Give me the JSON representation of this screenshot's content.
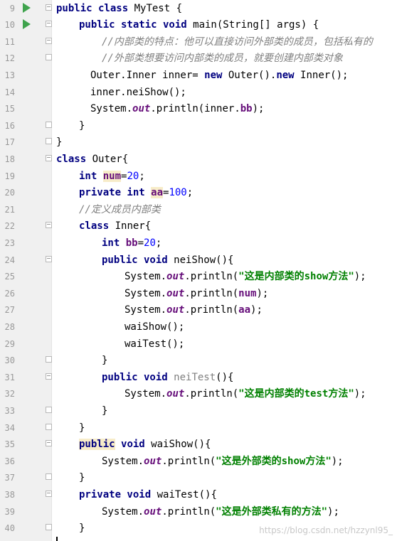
{
  "editor": {
    "lines": [
      {
        "n": "9",
        "indent": 0,
        "run": true,
        "fold": "open",
        "tokens": [
          {
            "t": "public class",
            "c": "kw"
          },
          {
            "t": " MyTest {",
            "c": ""
          }
        ]
      },
      {
        "n": "10",
        "indent": 1,
        "run": true,
        "fold": "open",
        "tokens": [
          {
            "t": "public static void",
            "c": "kw"
          },
          {
            "t": " main(String[] args) {",
            "c": ""
          }
        ]
      },
      {
        "n": "11",
        "indent": 2,
        "fold": "open",
        "tokens": [
          {
            "t": "//内部类的特点：他可以直接访问外部类的成员，包括私有的",
            "c": "cm"
          }
        ]
      },
      {
        "n": "12",
        "indent": 2,
        "fold": "close",
        "tokens": [
          {
            "t": "//外部类想要访问内部类的成员，就要创建内部类对象",
            "c": "cm"
          }
        ]
      },
      {
        "n": "13",
        "indent": 1.5,
        "tokens": [
          {
            "t": "Outer.Inner inner= ",
            "c": ""
          },
          {
            "t": "new",
            "c": "kw"
          },
          {
            "t": " Outer().",
            "c": ""
          },
          {
            "t": "new",
            "c": "kw"
          },
          {
            "t": " Inner();",
            "c": ""
          }
        ]
      },
      {
        "n": "14",
        "indent": 1.5,
        "tokens": [
          {
            "t": "inner.neiShow();",
            "c": ""
          }
        ]
      },
      {
        "n": "15",
        "indent": 1.5,
        "tokens": [
          {
            "t": "System.",
            "c": ""
          },
          {
            "t": "out",
            "c": "sfld"
          },
          {
            "t": ".println(inner.",
            "c": ""
          },
          {
            "t": "bb",
            "c": "fld"
          },
          {
            "t": ");",
            "c": ""
          }
        ]
      },
      {
        "n": "16",
        "indent": 1,
        "fold": "close",
        "tokens": [
          {
            "t": "}",
            "c": ""
          }
        ]
      },
      {
        "n": "17",
        "indent": 0,
        "fold": "close",
        "tokens": [
          {
            "t": "}",
            "c": ""
          }
        ]
      },
      {
        "n": "18",
        "indent": 0,
        "fold": "open",
        "tokens": [
          {
            "t": "class",
            "c": "kw"
          },
          {
            "t": " Outer{",
            "c": ""
          }
        ]
      },
      {
        "n": "19",
        "indent": 1,
        "tokens": [
          {
            "t": "int",
            "c": "kw"
          },
          {
            "t": " ",
            "c": ""
          },
          {
            "t": "num",
            "c": "fld hl"
          },
          {
            "t": "=",
            "c": ""
          },
          {
            "t": "20",
            "c": "num"
          },
          {
            "t": ";",
            "c": ""
          }
        ]
      },
      {
        "n": "20",
        "indent": 1,
        "tokens": [
          {
            "t": "private int",
            "c": "kw"
          },
          {
            "t": " ",
            "c": ""
          },
          {
            "t": "aa",
            "c": "fld hl"
          },
          {
            "t": "=",
            "c": ""
          },
          {
            "t": "100",
            "c": "num"
          },
          {
            "t": ";",
            "c": ""
          }
        ]
      },
      {
        "n": "21",
        "indent": 1,
        "tokens": [
          {
            "t": "//定义成员内部类",
            "c": "cm"
          }
        ]
      },
      {
        "n": "22",
        "indent": 1,
        "fold": "open",
        "tokens": [
          {
            "t": "class",
            "c": "kw"
          },
          {
            "t": " Inner{",
            "c": ""
          }
        ]
      },
      {
        "n": "23",
        "indent": 2,
        "tokens": [
          {
            "t": "int",
            "c": "kw"
          },
          {
            "t": " ",
            "c": ""
          },
          {
            "t": "bb",
            "c": "fld"
          },
          {
            "t": "=",
            "c": ""
          },
          {
            "t": "20",
            "c": "num"
          },
          {
            "t": ";",
            "c": ""
          }
        ]
      },
      {
        "n": "24",
        "indent": 2,
        "fold": "open",
        "tokens": [
          {
            "t": "public void",
            "c": "kw"
          },
          {
            "t": " neiShow(){",
            "c": ""
          }
        ]
      },
      {
        "n": "25",
        "indent": 3,
        "tokens": [
          {
            "t": "System.",
            "c": ""
          },
          {
            "t": "out",
            "c": "sfld"
          },
          {
            "t": ".println(",
            "c": ""
          },
          {
            "t": "\"这是内部类的show方法\"",
            "c": "str"
          },
          {
            "t": ");",
            "c": ""
          }
        ]
      },
      {
        "n": "26",
        "indent": 3,
        "tokens": [
          {
            "t": "System.",
            "c": ""
          },
          {
            "t": "out",
            "c": "sfld"
          },
          {
            "t": ".println(",
            "c": ""
          },
          {
            "t": "num",
            "c": "fld"
          },
          {
            "t": ");",
            "c": ""
          }
        ]
      },
      {
        "n": "27",
        "indent": 3,
        "tokens": [
          {
            "t": "System.",
            "c": ""
          },
          {
            "t": "out",
            "c": "sfld"
          },
          {
            "t": ".println(",
            "c": ""
          },
          {
            "t": "aa",
            "c": "fld"
          },
          {
            "t": ");",
            "c": ""
          }
        ]
      },
      {
        "n": "28",
        "indent": 3,
        "tokens": [
          {
            "t": "waiShow();",
            "c": ""
          }
        ]
      },
      {
        "n": "29",
        "indent": 3,
        "tokens": [
          {
            "t": "waiTest();",
            "c": ""
          }
        ]
      },
      {
        "n": "30",
        "indent": 2,
        "fold": "close",
        "tokens": [
          {
            "t": "}",
            "c": ""
          }
        ]
      },
      {
        "n": "31",
        "indent": 2,
        "fold": "open",
        "tokens": [
          {
            "t": "public void",
            "c": "kw"
          },
          {
            "t": " ",
            "c": ""
          },
          {
            "t": "neiTest",
            "c": "gray"
          },
          {
            "t": "(){",
            "c": ""
          }
        ]
      },
      {
        "n": "32",
        "indent": 3,
        "tokens": [
          {
            "t": "System.",
            "c": ""
          },
          {
            "t": "out",
            "c": "sfld"
          },
          {
            "t": ".println(",
            "c": ""
          },
          {
            "t": "\"这是内部类的test方法\"",
            "c": "str"
          },
          {
            "t": ");",
            "c": ""
          }
        ]
      },
      {
        "n": "33",
        "indent": 2,
        "fold": "close",
        "tokens": [
          {
            "t": "}",
            "c": ""
          }
        ]
      },
      {
        "n": "34",
        "indent": 1,
        "fold": "close",
        "tokens": [
          {
            "t": "}",
            "c": ""
          }
        ]
      },
      {
        "n": "35",
        "indent": 1,
        "fold": "open",
        "tokens": [
          {
            "t": "public",
            "c": "kw hl"
          },
          {
            "t": " ",
            "c": ""
          },
          {
            "t": "void",
            "c": "kw"
          },
          {
            "t": " waiShow(){",
            "c": ""
          }
        ]
      },
      {
        "n": "36",
        "indent": 2,
        "tokens": [
          {
            "t": "System.",
            "c": ""
          },
          {
            "t": "out",
            "c": "sfld"
          },
          {
            "t": ".println(",
            "c": ""
          },
          {
            "t": "\"这是外部类的show方法\"",
            "c": "str"
          },
          {
            "t": ");",
            "c": ""
          }
        ]
      },
      {
        "n": "37",
        "indent": 1,
        "fold": "close",
        "tokens": [
          {
            "t": "}",
            "c": ""
          }
        ]
      },
      {
        "n": "38",
        "indent": 1,
        "fold": "open",
        "tokens": [
          {
            "t": "private void",
            "c": "kw"
          },
          {
            "t": " waiTest(){",
            "c": ""
          }
        ]
      },
      {
        "n": "39",
        "indent": 2,
        "tokens": [
          {
            "t": "System.",
            "c": ""
          },
          {
            "t": "out",
            "c": "sfld"
          },
          {
            "t": ".println(",
            "c": ""
          },
          {
            "t": "\"这是外部类私有的方法\"",
            "c": "str"
          },
          {
            "t": ");",
            "c": ""
          }
        ]
      },
      {
        "n": "40",
        "indent": 1,
        "fold": "close",
        "tokens": [
          {
            "t": "}",
            "c": ""
          }
        ]
      }
    ]
  },
  "watermark": "https://blog.csdn.net/hzzynl95_",
  "colors": {
    "keyword": "#000080",
    "comment": "#808080",
    "string": "#008000",
    "number": "#0000ff",
    "field": "#660e7a",
    "run_icon": "#3fa34d",
    "highlight": "#f7ecc9"
  }
}
